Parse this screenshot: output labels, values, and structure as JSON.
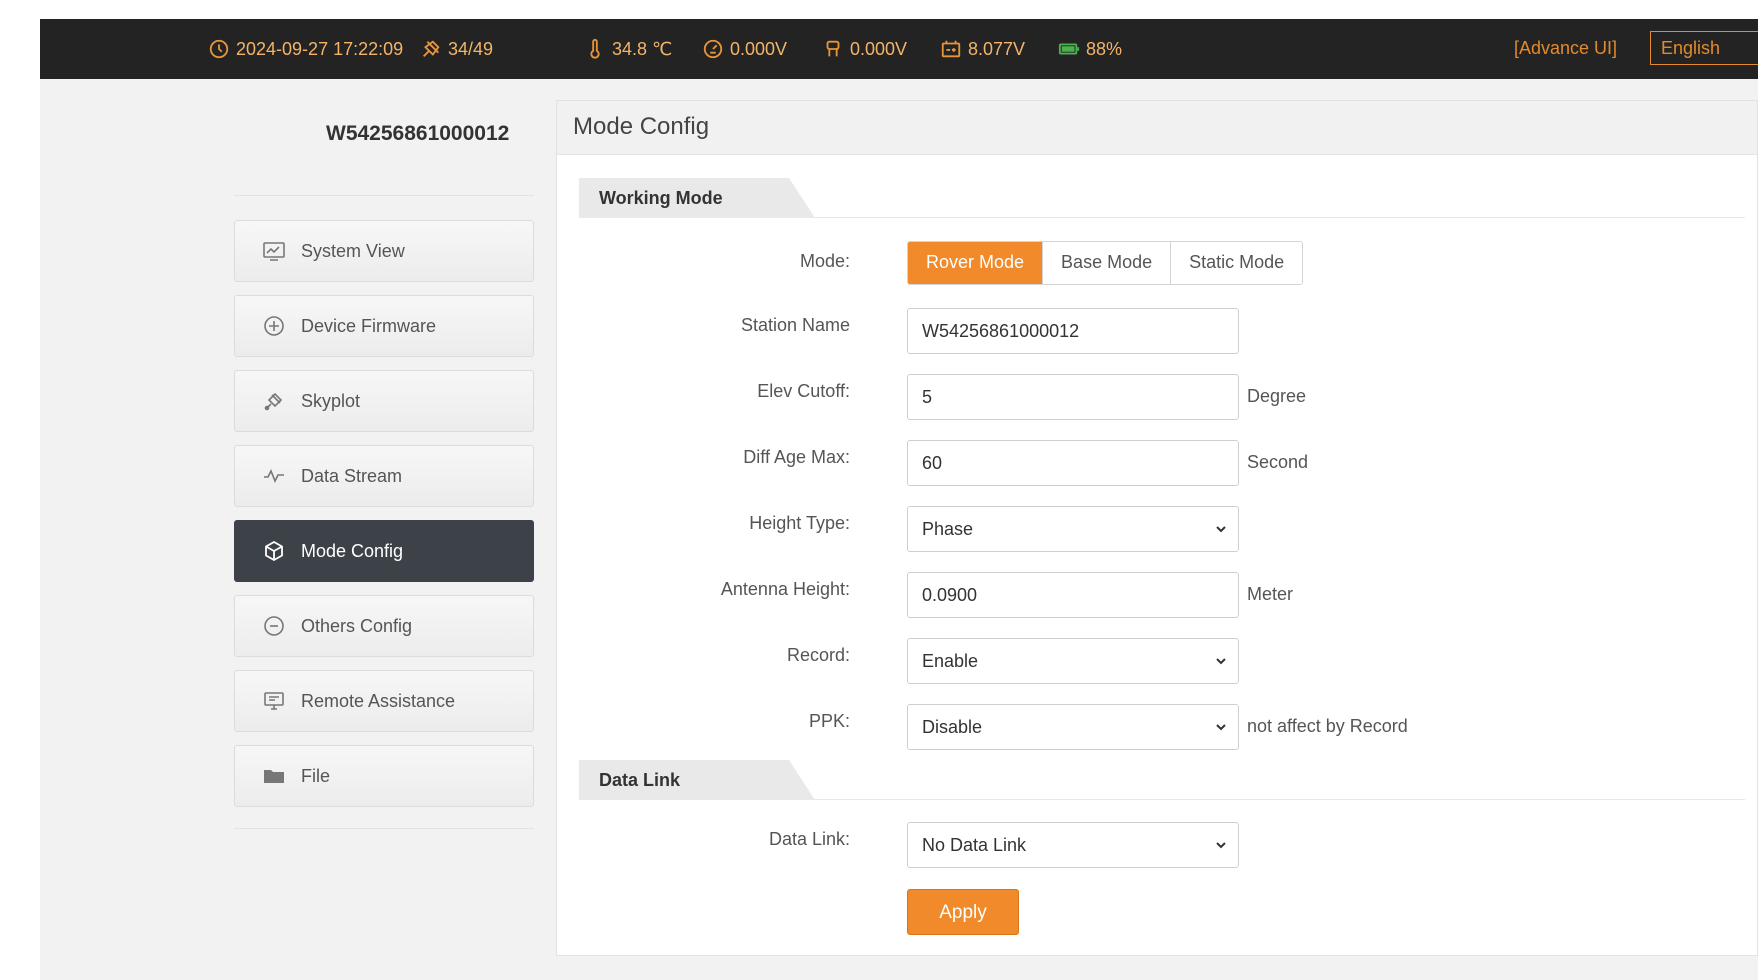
{
  "status_bar": {
    "datetime": "2024-09-27 17:22:09",
    "satellites": "34/49",
    "temperature": "34.8 ℃",
    "voltage_a": "0.000V",
    "voltage_b": "0.000V",
    "battery_voltage": "8.077V",
    "battery_percent": "88%",
    "advance_ui": "[Advance UI]",
    "language": "English"
  },
  "sidebar": {
    "device_id": "W54256861000012",
    "items": [
      {
        "label": "System View",
        "icon": "monitor-chart-icon",
        "active": false
      },
      {
        "label": "Device Firmware",
        "icon": "firmware-icon",
        "active": false
      },
      {
        "label": "Skyplot",
        "icon": "satellite-icon",
        "active": false
      },
      {
        "label": "Data Stream",
        "icon": "waveform-icon",
        "active": false
      },
      {
        "label": "Mode Config",
        "icon": "cube-icon",
        "active": true
      },
      {
        "label": "Others Config",
        "icon": "more-circle-icon",
        "active": false
      },
      {
        "label": "Remote Assistance",
        "icon": "remote-screen-icon",
        "active": false
      },
      {
        "label": "File",
        "icon": "folder-icon",
        "active": false
      }
    ]
  },
  "panel": {
    "title": "Mode Config",
    "working_mode": {
      "section_title": "Working Mode",
      "mode_label": "Mode:",
      "modes": [
        "Rover Mode",
        "Base Mode",
        "Static Mode"
      ],
      "selected_mode": "Rover Mode",
      "station_name_label": "Station Name",
      "station_name_value": "W54256861000012",
      "elev_cutoff_label": "Elev Cutoff:",
      "elev_cutoff_value": "5",
      "elev_cutoff_unit": "Degree",
      "diff_age_label": "Diff Age Max:",
      "diff_age_value": "60",
      "diff_age_unit": "Second",
      "height_type_label": "Height Type:",
      "height_type_value": "Phase",
      "antenna_height_label": "Antenna Height:",
      "antenna_height_value": "0.0900",
      "antenna_height_unit": "Meter",
      "record_label": "Record:",
      "record_value": "Enable",
      "ppk_label": "PPK:",
      "ppk_value": "Disable",
      "ppk_note": "not affect by Record"
    },
    "data_link": {
      "section_title": "Data Link",
      "label": "Data Link:",
      "value": "No Data Link"
    },
    "apply_label": "Apply"
  },
  "colors": {
    "accent": "#f08a2a",
    "topbar_bg": "#232323",
    "topbar_text": "#f0a050",
    "active_nav_bg": "#3d4248"
  }
}
